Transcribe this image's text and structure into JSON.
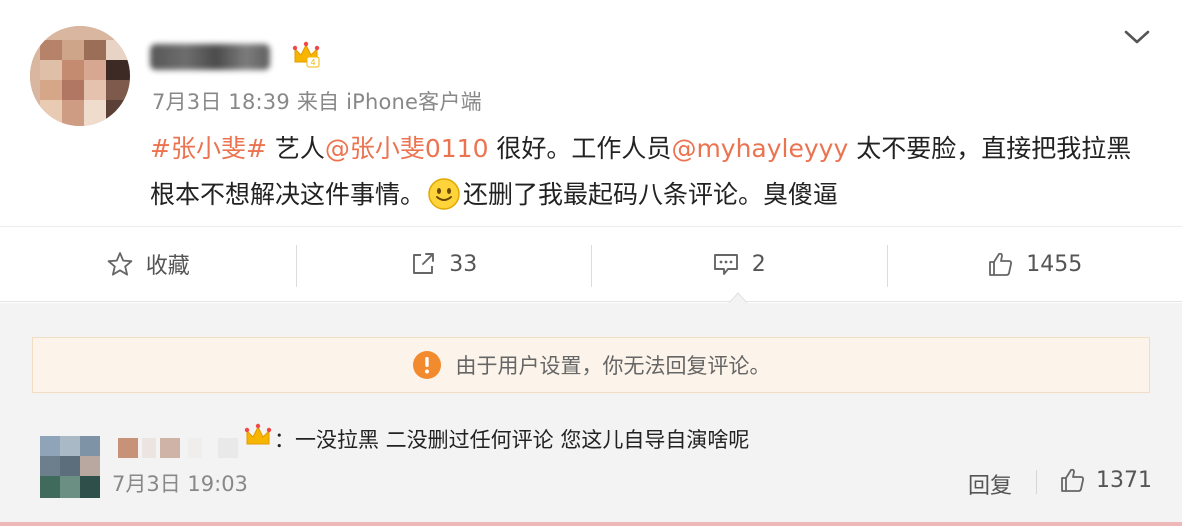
{
  "post": {
    "time": "7月3日 18:39",
    "source": "来自 iPhone客户端",
    "body": {
      "topic": "#张小斐#",
      "t1": " 艺人",
      "mention1": "@张小斐0110",
      "t2": " 很好。工作人员",
      "mention2": "@myhayleyyy",
      "t3": " 太不要脸，直接把我拉黑根本不想解决这件事情。",
      "t4": "还删了我最起码八条评论。臭傻逼"
    }
  },
  "actions": {
    "favorite": "收藏",
    "repost_count": "33",
    "comment_count": "2",
    "like_count": "1455"
  },
  "notice": {
    "text": "由于用户设置，你无法回复评论。"
  },
  "comment": {
    "text": "：一没拉黑 二没删过任何评论 您这儿自导自演啥呢",
    "time": "7月3日 19:03",
    "reply_label": "回复",
    "like_count": "1371"
  },
  "icons": {
    "more": "chevron-down-icon",
    "vip": "crown-icon",
    "favorite": "star-icon",
    "repost": "share-arrow-icon",
    "comment": "comment-bubble-icon",
    "like": "thumbs-up-icon",
    "notice": "warning-icon",
    "emoji": "smiley-emoji-icon"
  },
  "colors": {
    "accent": "#eb7350",
    "notice_bg": "#fcf4ea",
    "notice_icon": "#f28a2e",
    "crown": "#f7b500"
  }
}
